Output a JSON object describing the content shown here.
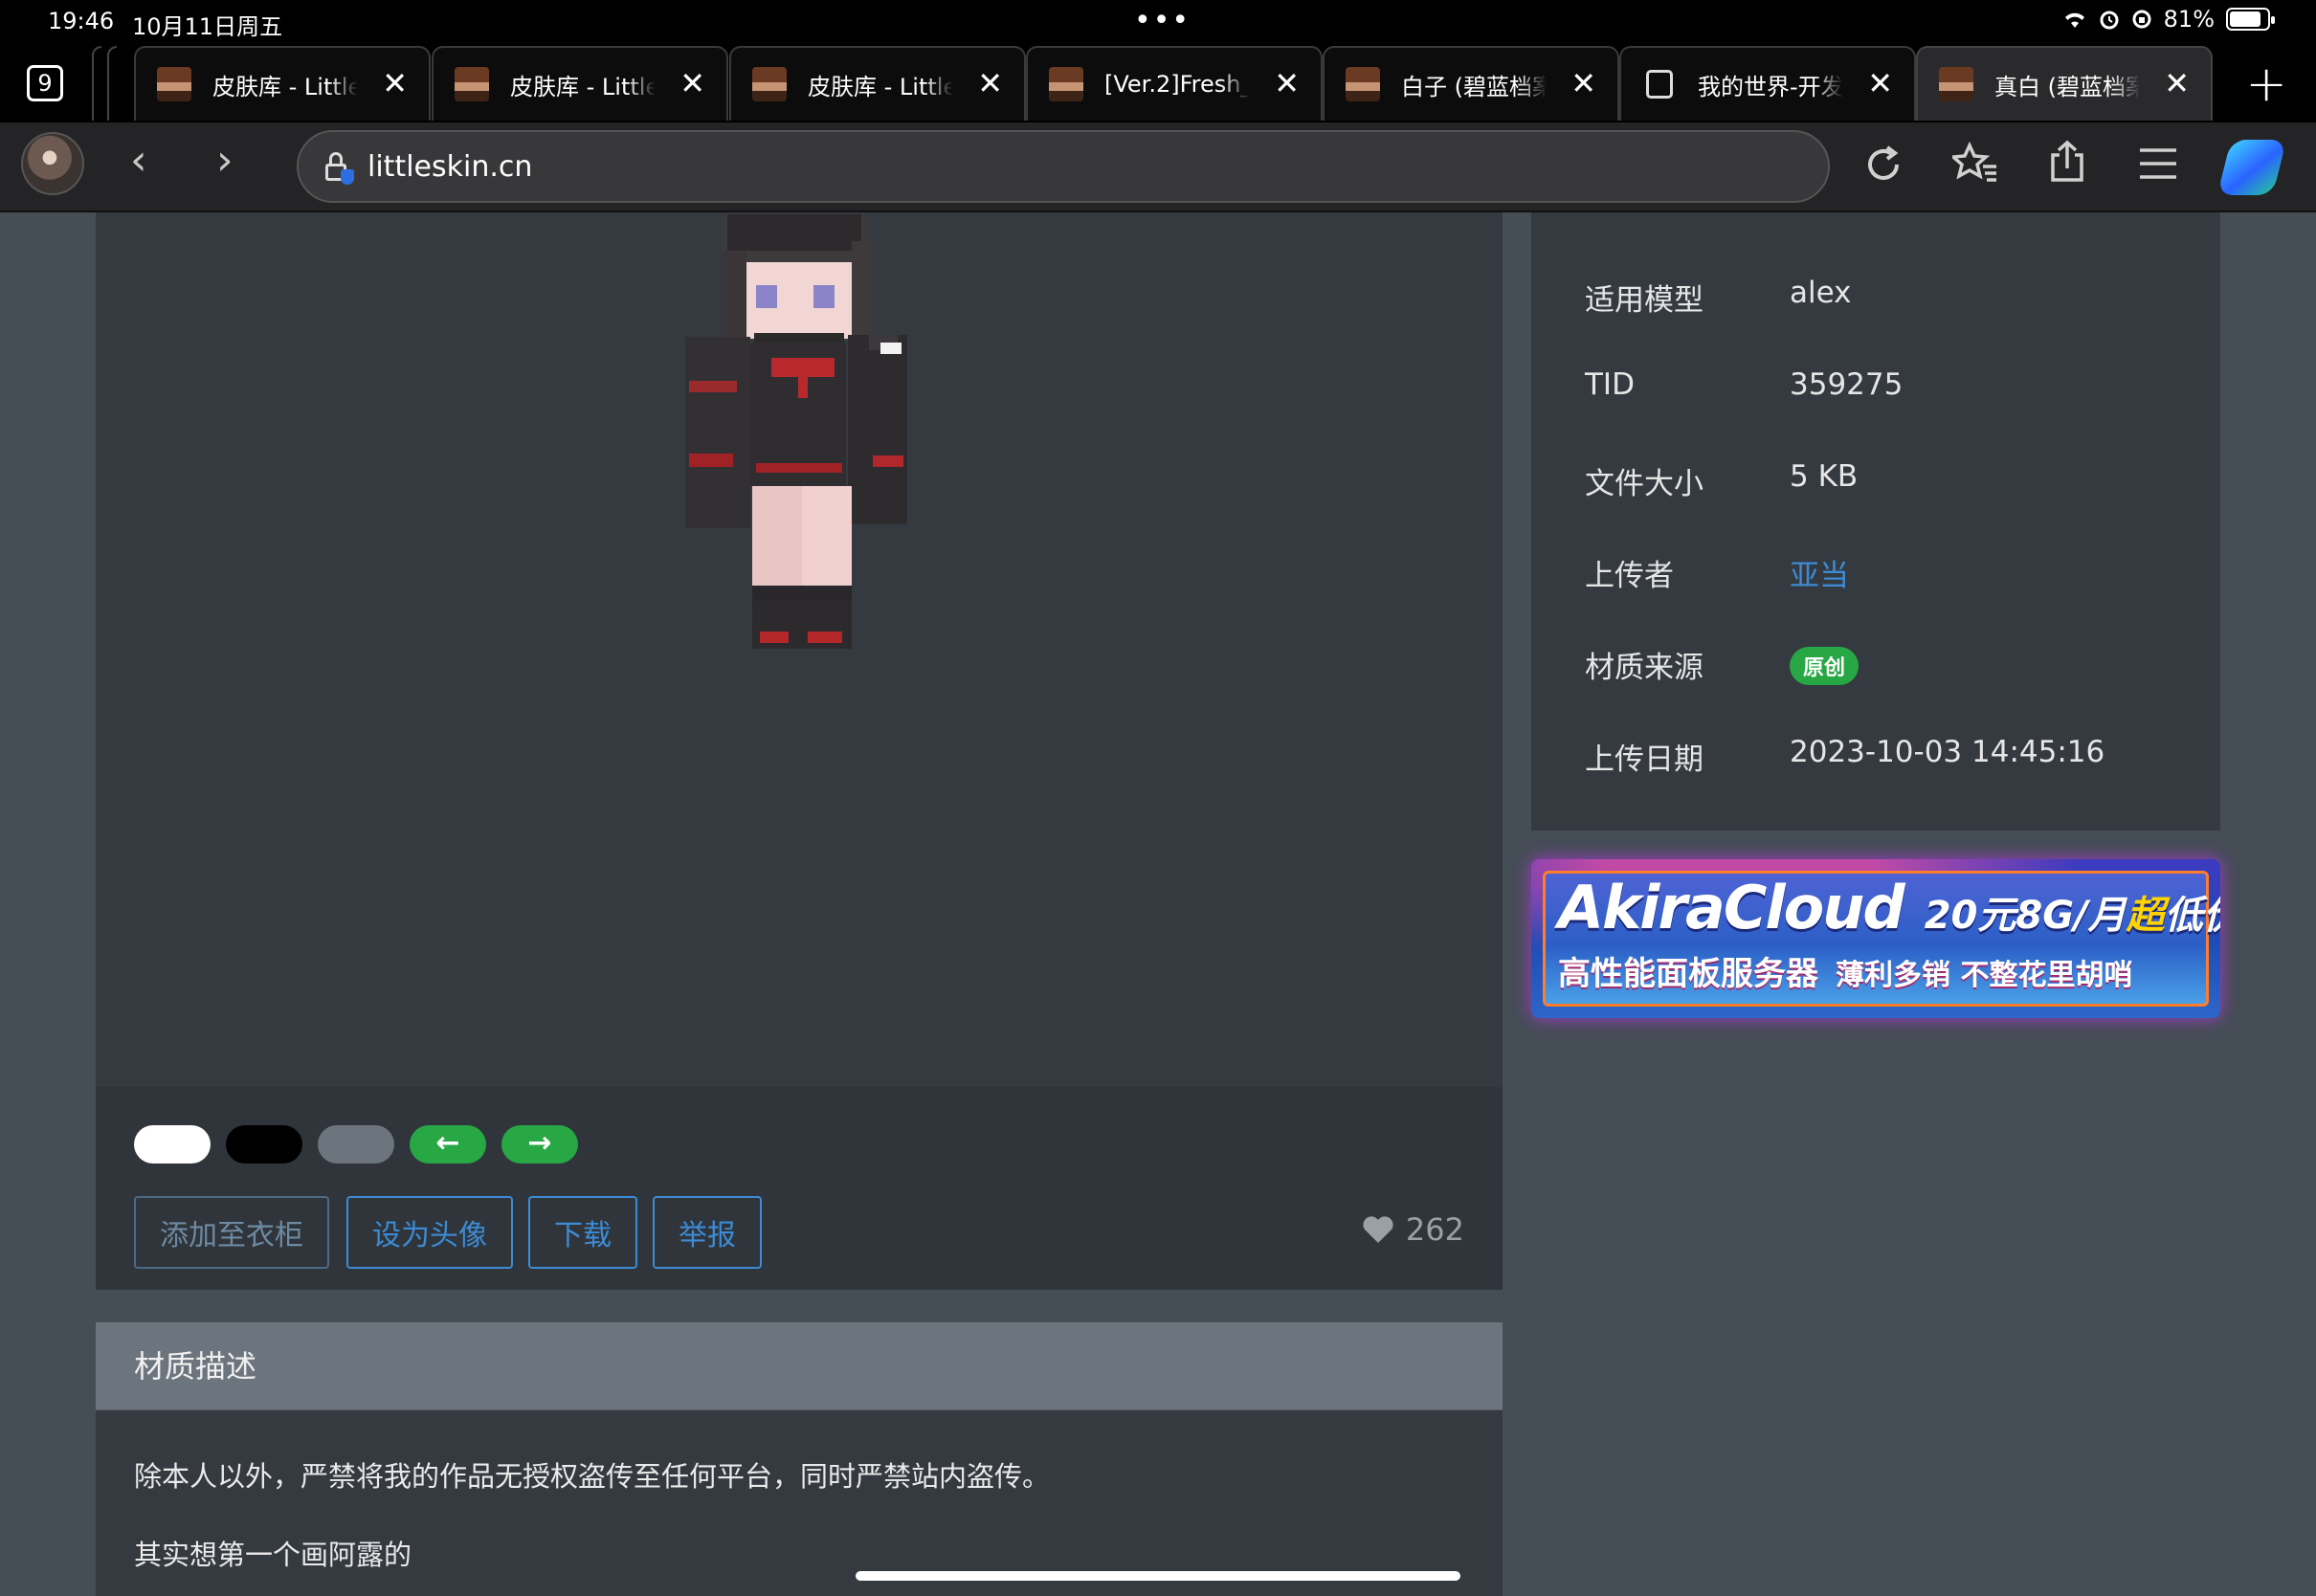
{
  "status_bar": {
    "time": "19:46",
    "date": "10月11日周五",
    "battery": "81%",
    "battery_level": 0.81
  },
  "tab_count": "9",
  "tabs": [
    {
      "title": "皮肤库 - LittleSkin",
      "favicon": "minecraft-head-icon"
    },
    {
      "title": "皮肤库 - LittleSkin",
      "favicon": "minecraft-head-icon"
    },
    {
      "title": "皮肤库 - LittleSkin",
      "favicon": "minecraft-head-icon"
    },
    {
      "title": "[Ver.2]Fresh_",
      "favicon": "minecraft-head-icon"
    },
    {
      "title": "白子 (碧蓝档案",
      "favicon": "minecraft-head-icon"
    },
    {
      "title": "我的世界-开发",
      "favicon": "page-icon"
    },
    {
      "title": "真白 (碧蓝档案",
      "favicon": "minecraft-head-icon",
      "active": true
    }
  ],
  "address": {
    "url": "littleskin.cn"
  },
  "viewer": {
    "background_buttons": [
      {
        "name": "bg-white",
        "color": "#ffffff"
      },
      {
        "name": "bg-black",
        "color": "#000000"
      },
      {
        "name": "bg-gray",
        "color": "#6c757d"
      },
      {
        "name": "prev",
        "color": "#28a745",
        "icon": "arrow-left-icon"
      },
      {
        "name": "next",
        "color": "#28a745",
        "icon": "arrow-right-icon"
      }
    ],
    "actions": {
      "add_to_closet": "添加至衣柜",
      "set_avatar": "设为头像",
      "download": "下载",
      "report": "举报"
    },
    "likes": "262"
  },
  "description": {
    "heading": "材质描述",
    "paragraphs": [
      "除本人以外，严禁将我的作品无授权盗传至任何平台，同时严禁站内盗传。",
      "其实想第一个画阿露的"
    ]
  },
  "info": {
    "rows": [
      {
        "label": "适用模型",
        "value": "alex"
      },
      {
        "label": "TID",
        "value": "359275"
      },
      {
        "label": "文件大小",
        "value": "5 KB"
      },
      {
        "label": "上传者",
        "value": "亚当"
      },
      {
        "label": "材质来源",
        "value": "原创"
      },
      {
        "label": "上传日期",
        "value": "2023-10-03 14:45:16"
      }
    ]
  },
  "ad": {
    "brand": "AkiraCloud",
    "price_prefix": "20元8G/月",
    "price_highlight": "超",
    "price_suffix": "低价!",
    "line2_a": "高性能面板服务器",
    "line2_b": "薄利多销 不整花里胡哨"
  },
  "colors": {
    "accent": "#3d8bd4",
    "success": "#28a745",
    "page_bg": "#454d55",
    "card_bg": "#343a40"
  }
}
